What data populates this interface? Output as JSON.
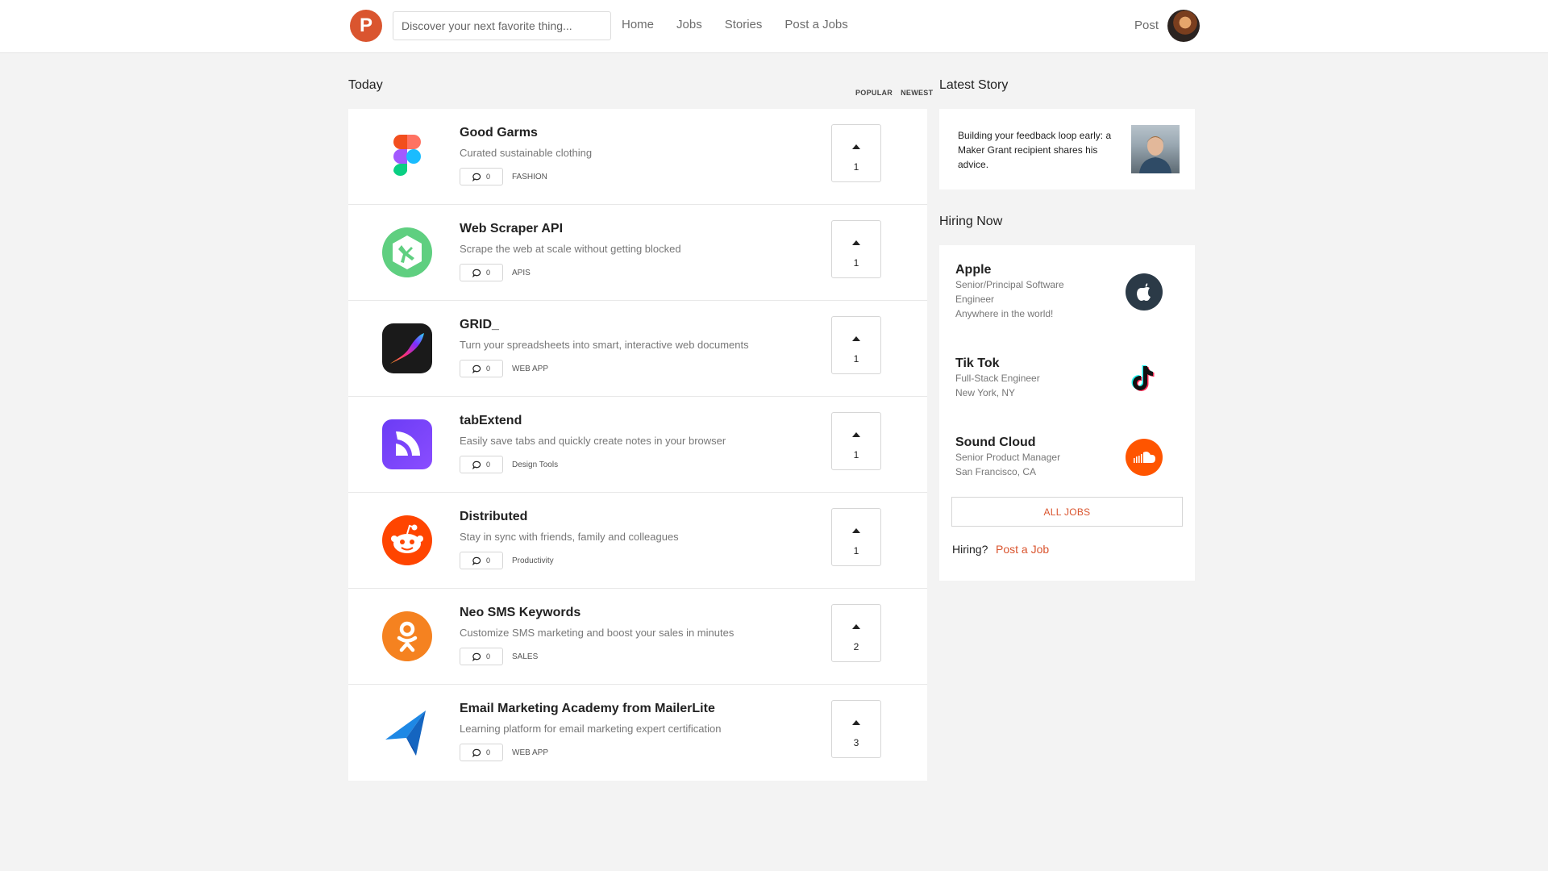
{
  "header": {
    "logo_letter": "P",
    "search_placeholder": "Discover your next favorite thing...",
    "nav": [
      "Home",
      "Jobs",
      "Stories",
      "Post a Jobs"
    ],
    "post_label": "Post"
  },
  "main": {
    "section_title": "Today",
    "sort": [
      "POPULAR",
      "NEWEST"
    ],
    "products": [
      {
        "name": "Good Garms",
        "tagline": "Curated sustainable clothing",
        "comments": "0",
        "topic": "FASHION",
        "votes": "1",
        "icon": "figma-icon"
      },
      {
        "name": "Web Scraper API",
        "tagline": "Scrape the web at scale without getting blocked",
        "comments": "0",
        "topic": "APIS",
        "votes": "1",
        "icon": "treehouse-icon"
      },
      {
        "name": "GRID_",
        "tagline": "Turn your spreadsheets into smart, interactive web documents",
        "comments": "0",
        "topic": "WEB APP",
        "votes": "1",
        "icon": "procreate-icon"
      },
      {
        "name": "tabExtend",
        "tagline": "Easily save tabs and quickly create notes in your browser",
        "comments": "0",
        "topic": "Design Tools",
        "votes": "1",
        "icon": "tabextend-icon"
      },
      {
        "name": "Distributed",
        "tagline": "Stay in sync with friends, family and colleagues",
        "comments": "0",
        "topic": "Productivity",
        "votes": "1",
        "icon": "reddit-icon"
      },
      {
        "name": "Neo SMS Keywords",
        "tagline": "Customize SMS marketing and boost your sales in minutes",
        "comments": "0",
        "topic": "SALES",
        "votes": "2",
        "icon": "odnoklassniki-icon"
      },
      {
        "name": "Email Marketing Academy from MailerLite",
        "tagline": "Learning platform for email marketing expert certification",
        "comments": "0",
        "topic": "WEB APP",
        "votes": "3",
        "icon": "paper-plane-icon"
      }
    ]
  },
  "sidebar": {
    "story_title": "Latest Story",
    "story_text": "Building your feedback loop early: a Maker Grant recipient shares his advice.",
    "hiring_title": "Hiring Now",
    "jobs": [
      {
        "company": "Apple",
        "role": "Senior/Principal Software Engineer",
        "location": "Anywhere in the world!",
        "icon": "apple-icon"
      },
      {
        "company": "Tik Tok",
        "role": "Full-Stack Engineer",
        "location": "New York, NY",
        "icon": "tiktok-icon"
      },
      {
        "company": "Sound Cloud",
        "role": "Senior Product Manager",
        "location": "San Francisco, CA",
        "icon": "soundcloud-icon"
      }
    ],
    "all_jobs_label": "ALL JOBS",
    "hiring_question": "Hiring?",
    "post_job_label": "Post a Job"
  },
  "colors": {
    "brand": "#da552f",
    "background": "#f3f3f3"
  }
}
